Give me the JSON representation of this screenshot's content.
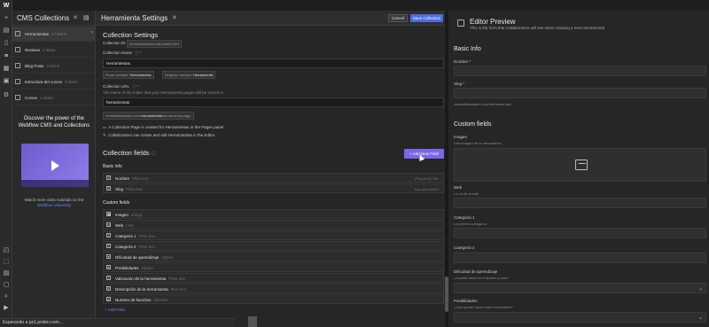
{
  "rail": {
    "logo": "W"
  },
  "collections": {
    "title": "CMS Collections",
    "items": [
      {
        "name": "Herramientas",
        "count": "27 items"
      },
      {
        "name": "Reviews",
        "count": "0 items"
      },
      {
        "name": "Blog Posts",
        "count": "0 items"
      },
      {
        "name": "Estructura del cursos",
        "count": "0 items"
      },
      {
        "name": "Cursos",
        "count": "1 items"
      }
    ],
    "promo": {
      "title": "Discover the power of the Webflow CMS and Collections",
      "caption": "Watch more video tutorials on the",
      "link": "Webflow University"
    }
  },
  "settings": {
    "title": "Herramienta Settings",
    "cancel": "Cancel",
    "save": "Save Collection",
    "section": "Collection Settings",
    "id_label": "Collection ID",
    "id_value": "5ecfcf6ab60a0ae361a6b51f3c3",
    "name_label": "Collection Name",
    "name_value": "Herramientas",
    "plural_label": "Plural variable",
    "plural_value": "Herramientas",
    "singular_label": "Singular variable",
    "singular_value": "Herramienta",
    "url_label": "Collection URL",
    "url_help": "The name of the folder that your Herramienta pages will be stored in",
    "url_value": "herramientas",
    "url_preview_prefix": "revistafatautustrn.com/",
    "url_preview_slug": "herramientas",
    "url_preview_suffix": "/herramienta-page",
    "note1": "A Collection Page is created for Herramientas in the Pages panel",
    "note2": "Collaborators can create and edit Herramientas in the Editor."
  },
  "fields": {
    "title": "Collection fields",
    "add_label": "Add New Field",
    "basic_title": "Basic info",
    "basic": [
      {
        "name": "Nombre",
        "hint": "Plain text",
        "right": "(Required) Title"
      },
      {
        "name": "Slug",
        "hint": "Plain text",
        "right": "Auto-generated"
      }
    ],
    "custom_title": "Custom fields",
    "custom": [
      {
        "name": "Imagen",
        "hint": "Image"
      },
      {
        "name": "Web",
        "hint": "Link"
      },
      {
        "name": "Categoría 1",
        "hint": "Plain text"
      },
      {
        "name": "Categoría 2",
        "hint": "Plain text"
      },
      {
        "name": "Dificultad de aprendizaje",
        "hint": "Option"
      },
      {
        "name": "Posibilidades",
        "hint": "Option"
      },
      {
        "name": "Valoración de la herramienta",
        "hint": "Plain text"
      },
      {
        "name": "Descripción de la herramienta",
        "hint": "Rich text"
      },
      {
        "name": "Numero de favoritos",
        "hint": "Number"
      }
    ],
    "add_field_link": "Add Field"
  },
  "preview": {
    "title": "Editor Preview",
    "subtitle": "This is the form that Collaborators will see when creating a new Herramienta",
    "basic": "Basic Info",
    "nombre": "Nombre *",
    "slug": "Slug *",
    "slug_hint": "revistafatautustrn.com/herramientas/",
    "custom": "Custom fields",
    "imagen": "Imagen",
    "imagen_hint": "Una imagen de la herramienta",
    "web": "Web",
    "web_hint": "La url de la web",
    "cat1": "Categoría 1",
    "cat1_hint": "La primera categoría",
    "cat2": "Categoría 2",
    "dificultad": "Dificultad de aprendizaje",
    "dificultad_hint": "¿Cuánto tarda en entender y usar?",
    "posibilidades": "Posibilidades",
    "posibilidades_hint": "¿Qué puede hacer esta herramienta?"
  },
  "status": "Esperando a ps1.pndsn.com..."
}
